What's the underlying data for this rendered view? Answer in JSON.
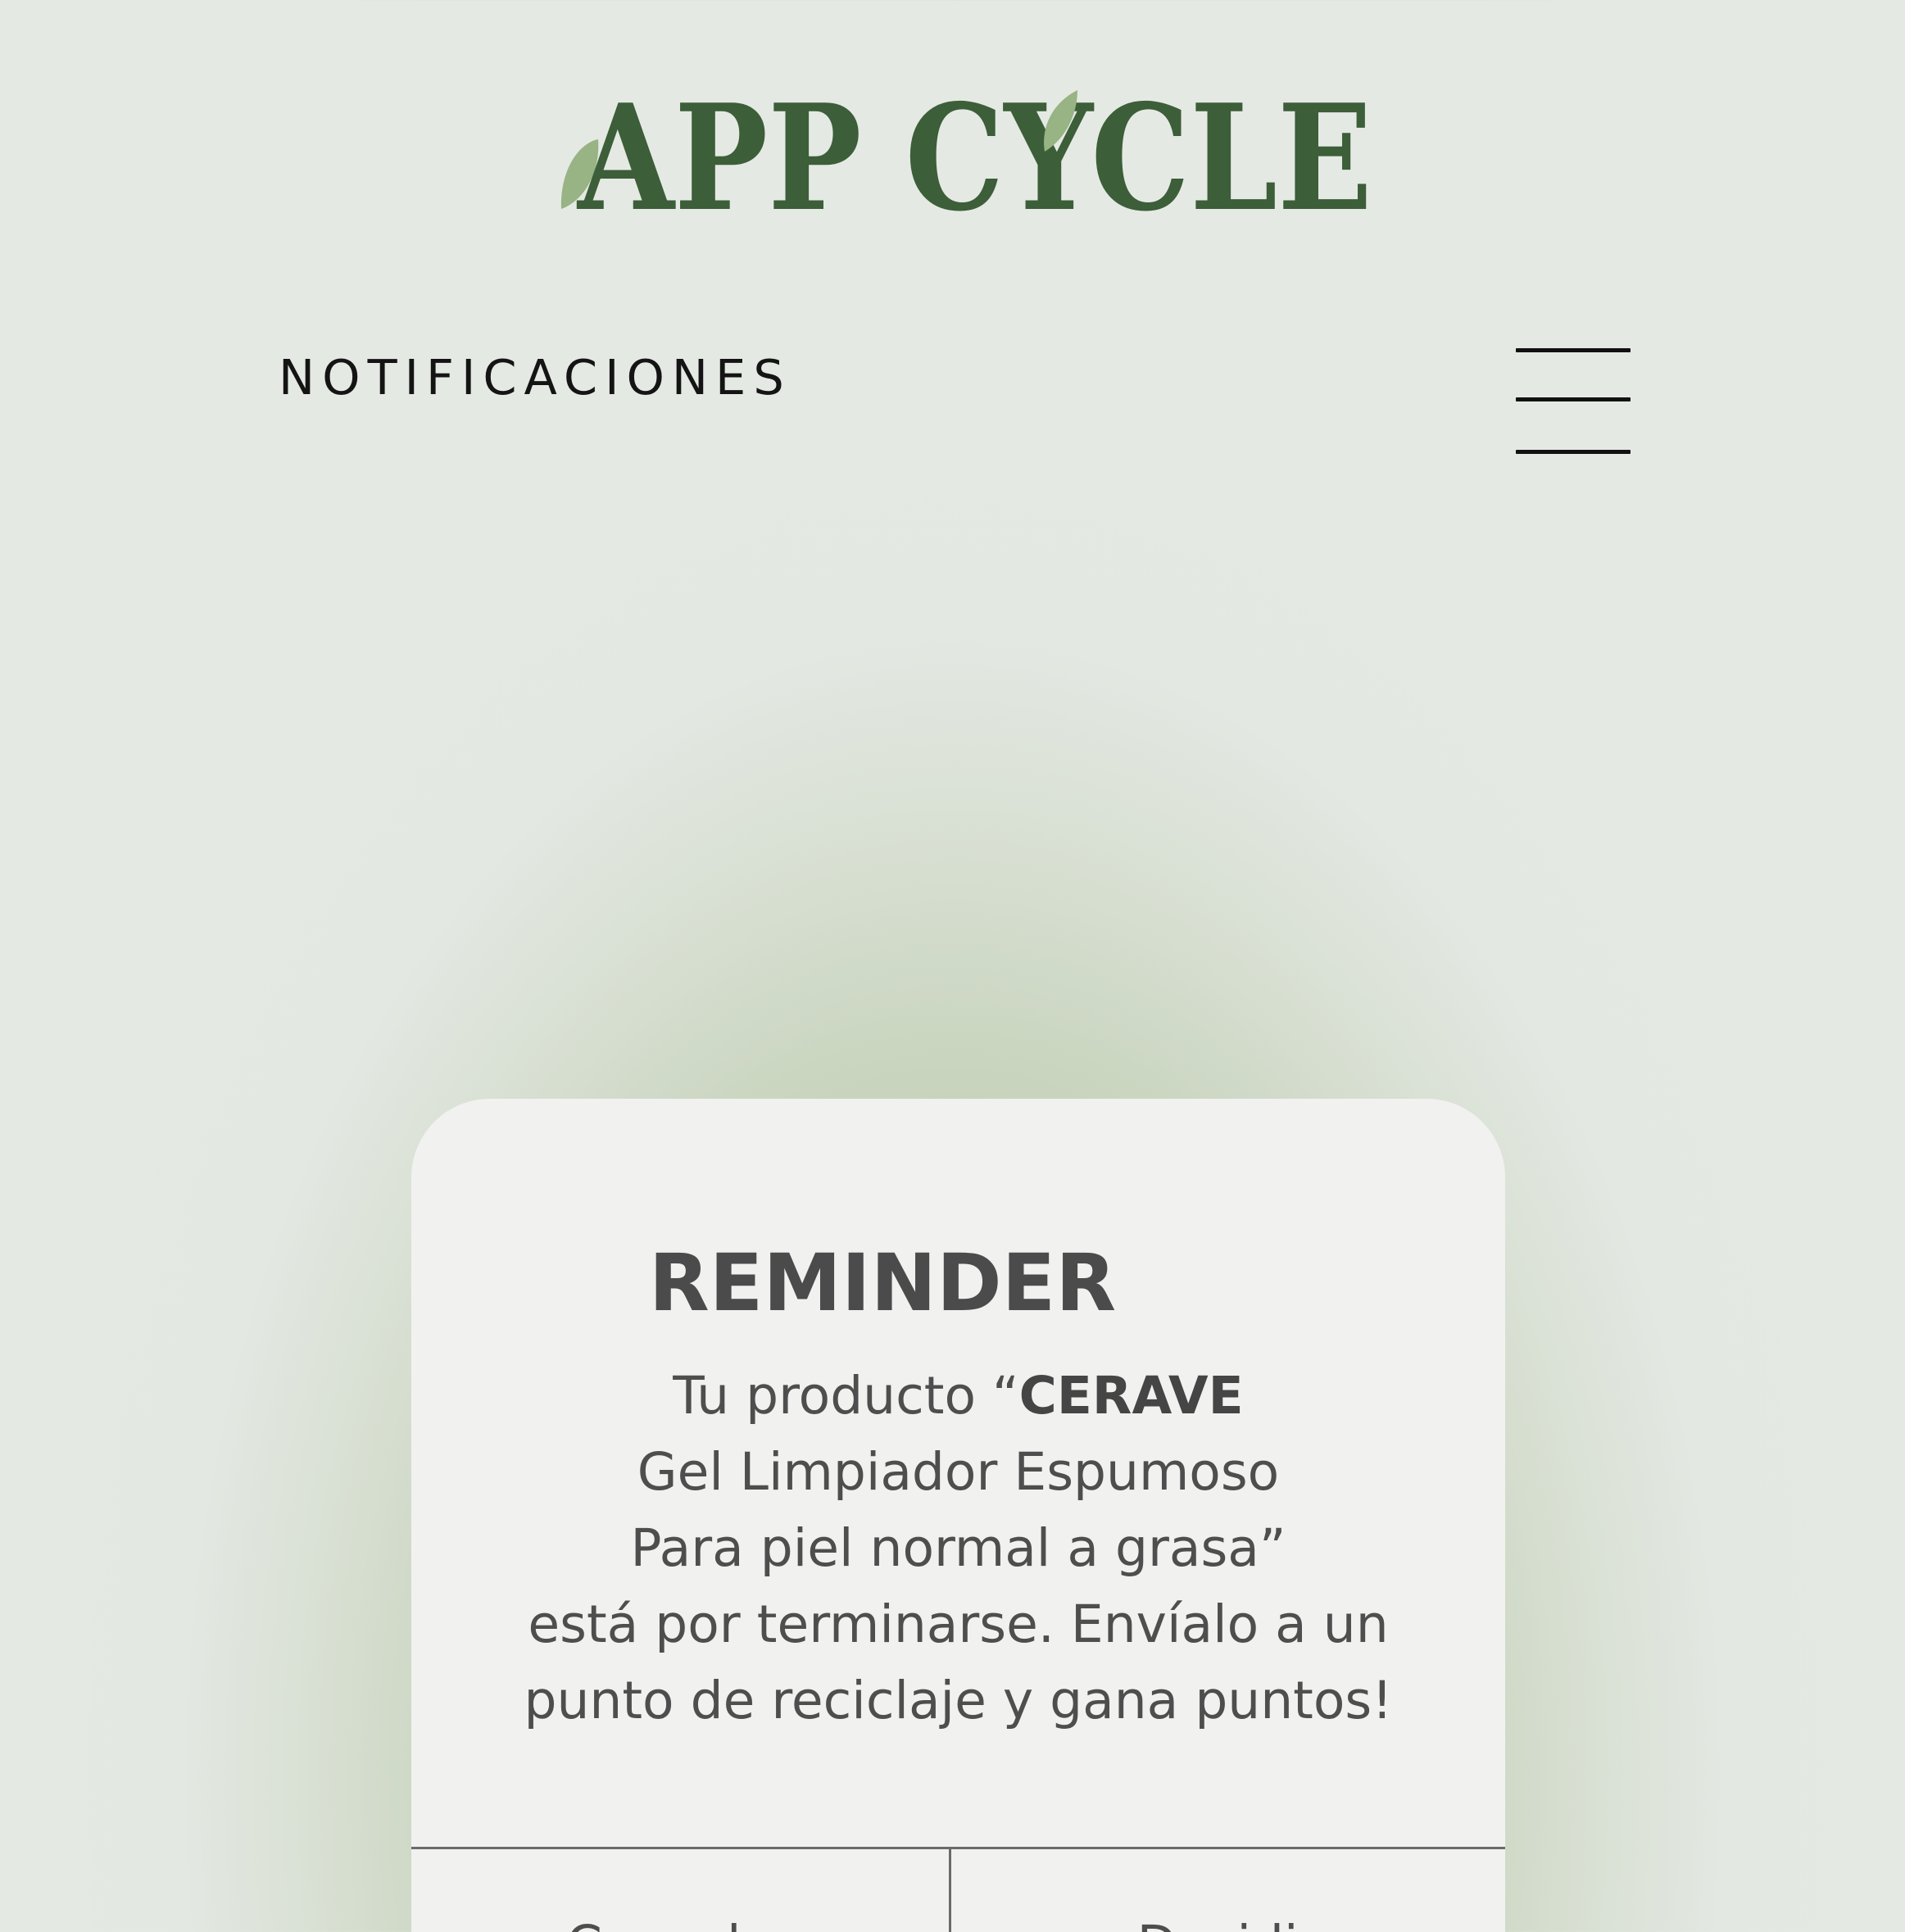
{
  "brand": {
    "logo_text": "APPCYCLE",
    "colors": {
      "primary": "#3c5e38",
      "leaf": "#98b384"
    }
  },
  "header": {
    "title": "NOTIFICACIONES",
    "menu_icon": "hamburger-menu-icon"
  },
  "notification": {
    "title": "REMINDER",
    "body": {
      "prefix": "Tu producto “",
      "product_brand": "CERAVE",
      "product_line_1": "Gel Limpiador Espumoso",
      "product_line_2": "Para piel normal a grasa”",
      "message_line_1": "está por terminarse. Envíalo a un",
      "message_line_2": "punto de reciclaje y gana puntos!"
    },
    "actions": {
      "left_label": "Cancelar",
      "right_label": "Decidir"
    }
  }
}
